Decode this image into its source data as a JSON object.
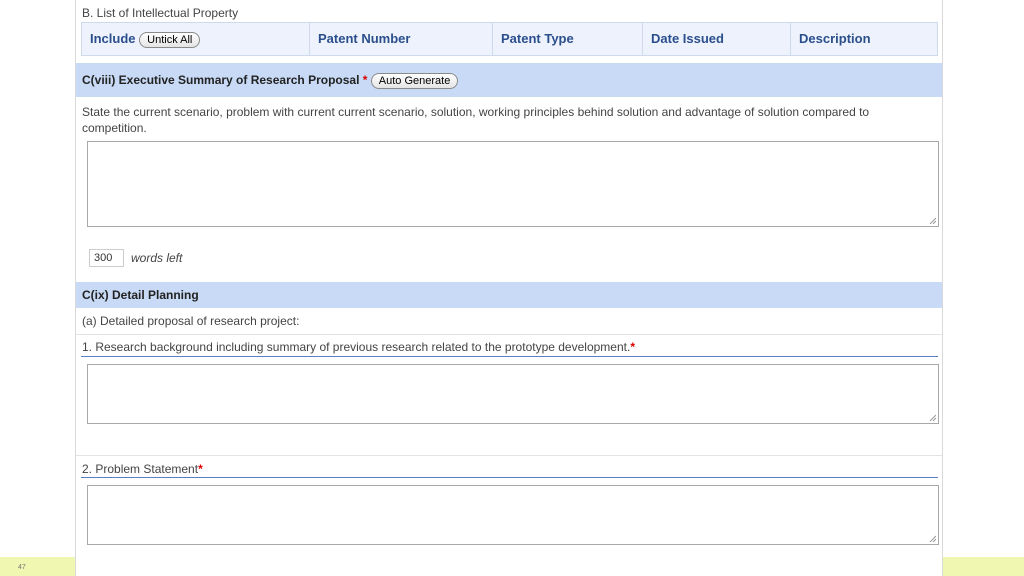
{
  "page_number": "47",
  "ip_section": {
    "title": "B. List of Intellectual Property",
    "include_label": "Include",
    "untick_all_label": "Untick All",
    "columns": [
      "Patent Number",
      "Patent Type",
      "Date Issued",
      "Description"
    ]
  },
  "summary_section": {
    "title": "C(viii) Executive Summary of Research Proposal ",
    "required_mark": "*",
    "auto_generate_label": "Auto Generate",
    "instructions": "State the current scenario, problem with current current scenario, solution, working principles behind solution and advantage of solution compared to competition.",
    "textarea_value": "",
    "words_count": "300",
    "words_left_label": "words left"
  },
  "planning_section": {
    "title": "C(ix) Detail Planning",
    "sub_heading": "(a) Detailed proposal of research project:",
    "item1_label": "1. Research background including summary of previous research related to the prototype development.",
    "item1_required": "*",
    "item1_value": "",
    "item2_label": "2. Problem Statement",
    "item2_required": "*",
    "item2_value": ""
  },
  "colors": {
    "section_bar": "#c8daf5",
    "header_text": "#2b4f8c",
    "required": "#dd0000",
    "slide_accent": "#f0f7b0"
  }
}
